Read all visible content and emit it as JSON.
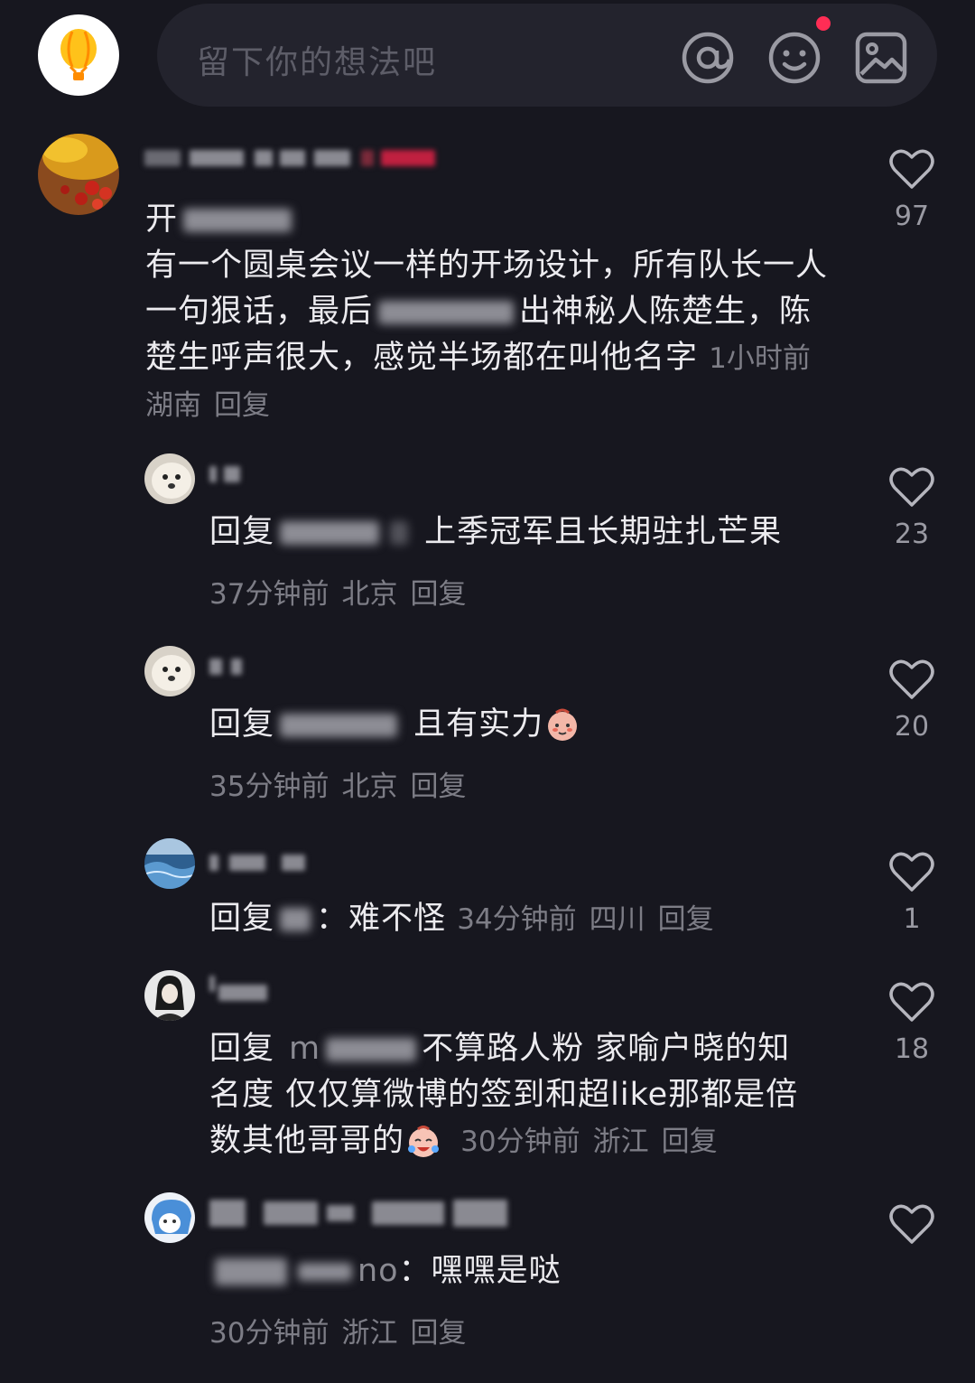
{
  "header": {
    "input_placeholder": "留下你的想法吧",
    "icons": [
      "balloon-icon",
      "at-icon",
      "emoji-icon",
      "image-icon"
    ],
    "notification_dot_color": "#ff2d55"
  },
  "comments": [
    {
      "text_prefix": "开",
      "text_suffix": "有一个圆桌会议一样的开场设计，所有队长一人一句狠话，最后",
      "text_tail": "出神秘人陈楚生，陈楚生呼声很大，感觉半场都在叫他名字",
      "time": "1小时前",
      "location": "湖南",
      "reply": "回复",
      "likes": "97"
    },
    {
      "reply_prefix": "回复",
      "text": "上季冠军且长期驻扎芒果",
      "time": "37分钟前",
      "location": "北京",
      "reply": "回复",
      "likes": "23"
    },
    {
      "reply_prefix": "回复",
      "text": "且有实力",
      "time": "35分钟前",
      "location": "北京",
      "reply": "回复",
      "likes": "20"
    },
    {
      "reply_prefix": "回复",
      "colon": "：",
      "text": "难不怪",
      "time": "34分钟前",
      "location": "四川",
      "reply": "回复",
      "likes": "1"
    },
    {
      "reply_prefix": "回复",
      "mention_visible": "m",
      "text_line1": "不算路人粉 家喻户晓的知",
      "text_line2": "名度 仅仅算微博的签到和超like那都是倍",
      "text_line3": "数其他哥哥的",
      "time": "30分钟前",
      "location": "浙江",
      "reply": "回复",
      "likes": "18"
    },
    {
      "mention_visible": "no",
      "colon": "：",
      "text": "嘿嘿是哒",
      "time": "30分钟前",
      "location": "浙江",
      "reply": "回复",
      "likes": ""
    }
  ]
}
